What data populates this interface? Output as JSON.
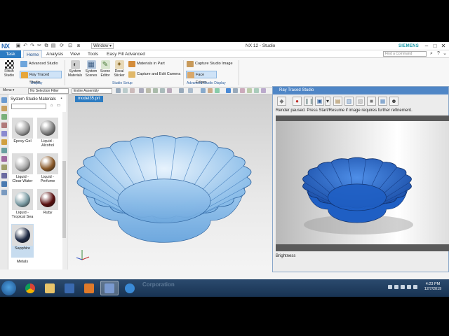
{
  "app": {
    "logo": "NX",
    "window_menu": "Window ▾",
    "title": "NX 12 - Studio",
    "brand": "SIEMENS",
    "command_search_placeholder": "Find a Command",
    "window_controls": [
      "–",
      "□",
      "✕"
    ]
  },
  "tabs": [
    {
      "label": "Task"
    },
    {
      "label": "Home"
    },
    {
      "label": "Analysis"
    },
    {
      "label": "View"
    },
    {
      "label": "Tools"
    },
    {
      "label": "Easy Fill Advanced"
    }
  ],
  "ribbon": {
    "finish_studio": "Finish Studio",
    "advanced_studio": "Advanced Studio",
    "ray_traced_studio": "Ray Traced Studio",
    "display_group": "Display",
    "system_materials": "System Materials",
    "system_scenes": "System Scenes",
    "scene_editor": "Scene Editor",
    "decal_sticker": "Decal Sticker",
    "materials_in_part": "Materials in Part",
    "capture_edit_camera": "Capture and Edit Camera",
    "studio_setup_group": "Studio Setup",
    "capture_studio_image": "Capture Studio Image",
    "face_edges": "Face Edges",
    "advanced_display_group": "Advanced Studio Display"
  },
  "toolbar2": {
    "menu": "Menu ▾",
    "selection_filter": "No Selection Filter",
    "assembly_scope": "Entire Assembly"
  },
  "materials_panel": {
    "title": "System Studio Materials",
    "items": [
      {
        "label": "Epoxy Gel",
        "color": "#9a9a9a"
      },
      {
        "label": "Liquid - Alcohol",
        "color": "#7d7d7d"
      },
      {
        "label": "Liquid - Clear Water",
        "color": "#a6a6a6"
      },
      {
        "label": "Liquid - Perfume",
        "color": "#8a5a2a"
      },
      {
        "label": "Liquid - Tropical Sea",
        "color": "#7a9aa2"
      },
      {
        "label": "Ruby",
        "color": "#5a1010"
      },
      {
        "label": "Sapphire",
        "color": "#1f2a44"
      }
    ],
    "partial_label": "Metals"
  },
  "viewport": {
    "tab": "model35.prt",
    "bowl_color": "#8fc1ec"
  },
  "ray_traced": {
    "title": "Ray Traced Studio",
    "status": "Render paused. Press Start/Resume if image requires further refinement.",
    "brightness": "Brightness",
    "bowl_color": "#1f5fc4"
  },
  "taskbar": {
    "watermark": "Corporation",
    "time": "4:23 PM",
    "date": "12/7/2019"
  }
}
